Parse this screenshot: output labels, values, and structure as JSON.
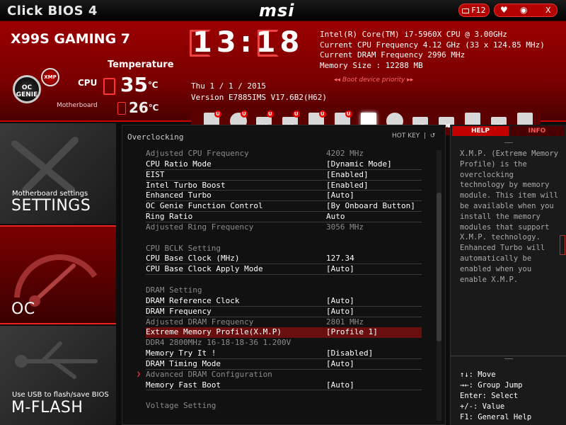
{
  "topbar": {
    "title": "Click BIOS 4",
    "brand": "msi",
    "f12_label": "F12",
    "close_label": "X"
  },
  "header": {
    "board_name": "X99S GAMING 7",
    "temperature_title": "Temperature",
    "cpu_label": "CPU",
    "motherboard_label": "Motherboard",
    "cpu_temp": "35",
    "mb_temp": "26",
    "temp_unit": "℃",
    "oc_genie_label": "OC GENIE",
    "xmp_label": "XMP",
    "clock": "13:18",
    "date": "Thu  1 / 1 / 2015",
    "version": "Version E7885IMS V17.6B2(H62)",
    "sysinfo": [
      "Intel(R) Core(TM) i7-5960X CPU @ 3.00GHz",
      "Current CPU Frequency 4.12 GHz (33 x 124.85 MHz)",
      "Current DRAM Frequency 2996 MHz",
      "Memory Size : 12288 MB"
    ],
    "boot_priority_label": "Boot device priority",
    "boot_devices": [
      {
        "type": "hdd",
        "badge": "U",
        "usb": false
      },
      {
        "type": "disc",
        "badge": "U",
        "usb": false
      },
      {
        "type": "usb",
        "badge": "U",
        "usb": true
      },
      {
        "type": "usb",
        "badge": "U",
        "usb": true
      },
      {
        "type": "usb-key",
        "badge": "U",
        "usb": false
      },
      {
        "type": "hdd",
        "badge": "U",
        "usb": false
      },
      {
        "type": "card",
        "badge": "",
        "usb": false,
        "selected": true
      },
      {
        "type": "disc",
        "badge": "",
        "usb": false
      },
      {
        "type": "usb",
        "badge": "",
        "usb": true
      },
      {
        "type": "usb",
        "badge": "",
        "usb": true
      },
      {
        "type": "usb-key",
        "badge": "",
        "usb": false
      },
      {
        "type": "usb",
        "badge": "",
        "usb": true
      },
      {
        "type": "network",
        "badge": "",
        "usb": false
      }
    ]
  },
  "sidebar": {
    "settings_sub": "Motherboard settings",
    "settings_main": "SETTINGS",
    "oc_main": "OC",
    "mflash_sub": "Use USB to flash/save BIOS",
    "mflash_main": "M-FLASH"
  },
  "main": {
    "title": "Overclocking",
    "hotkey_label": "HOT KEY",
    "rows": [
      {
        "label": "Adjusted CPU Frequency",
        "value": "4202 MHz",
        "style": "dim"
      },
      {
        "label": "CPU Ratio Mode",
        "value": "[Dynamic Mode]",
        "style": "sep"
      },
      {
        "label": "EIST",
        "value": "[Enabled]",
        "style": "sep"
      },
      {
        "label": "Intel Turbo Boost",
        "value": "[Enabled]",
        "style": "sep"
      },
      {
        "label": "Enhanced Turbo",
        "value": "[Auto]",
        "style": "sep"
      },
      {
        "label": "OC Genie Function Control",
        "value": "[By Onboard Button]",
        "style": "sep"
      },
      {
        "label": "Ring Ratio",
        "value": "Auto",
        "style": "sep"
      },
      {
        "label": "Adjusted Ring Frequency",
        "value": "3056 MHz",
        "style": "dim"
      },
      {
        "label": "",
        "value": "",
        "style": "blank"
      },
      {
        "label": "CPU BCLK Setting",
        "value": "",
        "style": "dimhead"
      },
      {
        "label": "CPU Base Clock (MHz)",
        "value": "127.34",
        "style": "sep"
      },
      {
        "label": "CPU Base Clock Apply Mode",
        "value": "[Auto]",
        "style": "sep"
      },
      {
        "label": "",
        "value": "",
        "style": "blank"
      },
      {
        "label": "DRAM Setting",
        "value": "",
        "style": "dimhead"
      },
      {
        "label": "DRAM Reference Clock",
        "value": "[Auto]",
        "style": "sep"
      },
      {
        "label": "DRAM Frequency",
        "value": "[Auto]",
        "style": "sep"
      },
      {
        "label": "Adjusted DRAM Frequency",
        "value": "2801 MHz",
        "style": "dim"
      },
      {
        "label": "Extreme Memory Profile(X.M.P)",
        "value": "[Profile 1]",
        "style": "sel"
      },
      {
        "label": "DDR4 2800MHz 16-18-18-36 1.200V",
        "value": "",
        "style": "dim"
      },
      {
        "label": "Memory Try It !",
        "value": "[Disabled]",
        "style": "sep"
      },
      {
        "label": "DRAM Timing Mode",
        "value": "[Auto]",
        "style": "sep"
      },
      {
        "label": "Advanced DRAM Configuration",
        "value": "",
        "style": "dimarrow"
      },
      {
        "label": "Memory Fast Boot",
        "value": "[Auto]",
        "style": "sep"
      },
      {
        "label": "",
        "value": "",
        "style": "blank"
      },
      {
        "label": "Voltage Setting",
        "value": "",
        "style": "dimhead"
      }
    ]
  },
  "help": {
    "help_tab": "HELP",
    "info_tab": "INFO",
    "text": "X.M.P. (Extreme Memory Profile) is the overclocking technology by memory module. This item will be available when you install the memory modules that support X.M.P. technology. Enhanced Turbo will automatically be enabled when you enable X.M.P.",
    "keys": [
      "↑↓: Move",
      "→←: Group Jump",
      "Enter: Select",
      "+/-: Value",
      "F1: General Help"
    ]
  }
}
